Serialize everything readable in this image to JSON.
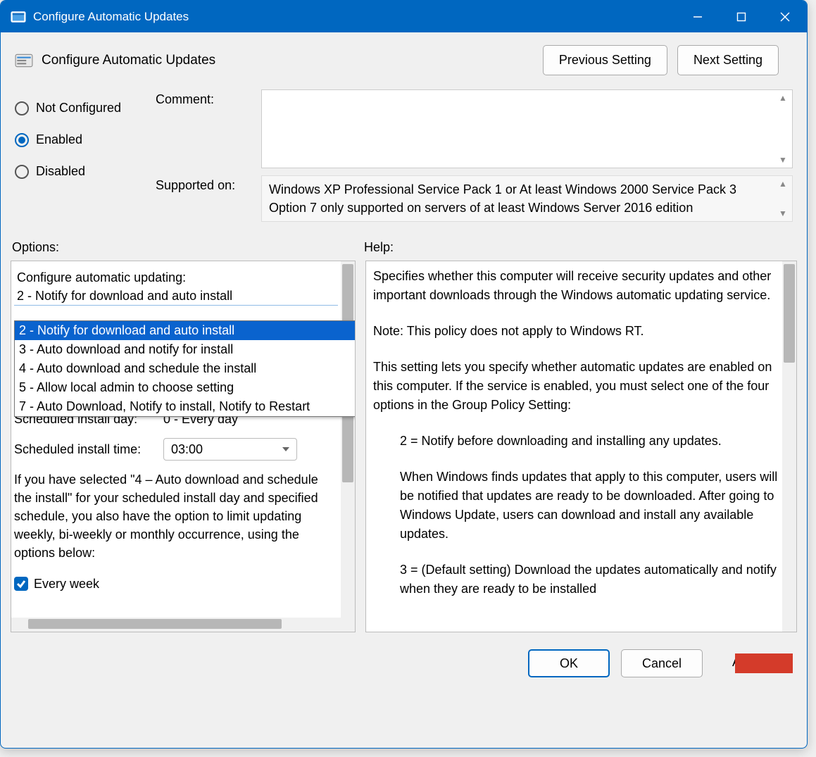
{
  "titlebar": {
    "title": "Configure Automatic Updates"
  },
  "header": {
    "title": "Configure Automatic Updates",
    "prev": "Previous Setting",
    "next": "Next Setting"
  },
  "state": {
    "not_configured": "Not Configured",
    "enabled": "Enabled",
    "disabled": "Disabled",
    "selected": "enabled"
  },
  "fields": {
    "comment_label": "Comment:",
    "comment_value": "",
    "supported_label": "Supported on:",
    "supported_text": "Windows XP Professional Service Pack 1 or At least Windows 2000 Service Pack 3 Option 7 only supported on servers of at least Windows Server 2016 edition"
  },
  "section_labels": {
    "options": "Options:",
    "help": "Help:"
  },
  "options": {
    "configure_label": "Configure automatic updating:",
    "current": "2 - Notify for download and auto install",
    "items": [
      "2 - Notify for download and auto install",
      "3 - Auto download and notify for install",
      "4 - Auto download and schedule the install",
      "5 - Allow local admin to choose setting",
      "7 - Auto Download, Notify to install, Notify to Restart"
    ],
    "highlight_index": 0,
    "sched_day_label": "Scheduled install day:",
    "sched_day_value": "0 - Every day",
    "sched_time_label": "Scheduled install time:",
    "sched_time_value": "03:00",
    "paragraph": "If you have selected \"4 – Auto download and schedule the install\" for your scheduled install day and specified schedule, you also have the option to limit updating weekly, bi-weekly or monthly occurrence, using the options below:",
    "every_week": "Every week",
    "every_week_checked": true
  },
  "help": {
    "p1": "Specifies whether this computer will receive security updates and other important downloads through the Windows automatic updating service.",
    "p2": "Note: This policy does not apply to Windows RT.",
    "p3": "This setting lets you specify whether automatic updates are enabled on this computer. If the service is enabled, you must select one of the four options in the Group Policy Setting:",
    "p4": "2 = Notify before downloading and installing any updates.",
    "p5": "When Windows finds updates that apply to this computer, users will be notified that updates are ready to be downloaded. After going to Windows Update, users can download and install any available updates.",
    "p6": "3 = (Default setting) Download the updates automatically and notify when they are ready to be installed"
  },
  "footer": {
    "ok": "OK",
    "cancel": "Cancel",
    "apply_hidden": "A"
  },
  "badge": {
    "text": ""
  }
}
